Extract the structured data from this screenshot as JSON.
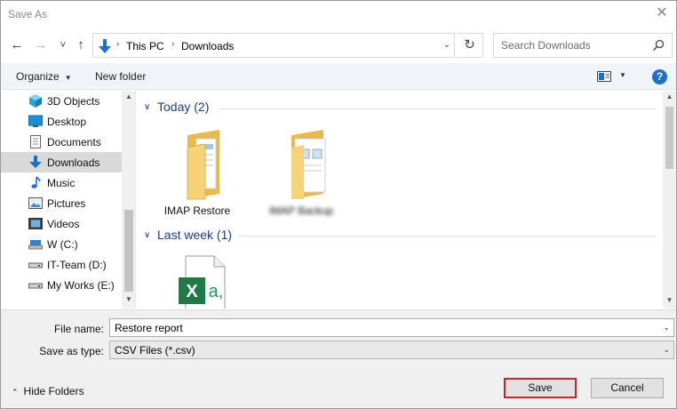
{
  "window": {
    "title": "Save As",
    "close_glyph": "✕"
  },
  "nav": {
    "back_glyph": "←",
    "forward_glyph": "→",
    "recent_glyph": "˅",
    "up_glyph": "↑",
    "breadcrumb": [
      "This PC",
      "Downloads"
    ],
    "breadcrumb_sep": "›",
    "address_dropdown_glyph": "⌄",
    "refresh_glyph": "↻",
    "search_placeholder": "Search Downloads"
  },
  "toolbar": {
    "organize_label": "Organize",
    "new_folder_label": "New folder",
    "help_glyph": "?",
    "dropdown_glyph": "▼"
  },
  "sidebar": {
    "items": [
      {
        "label": "3D Objects",
        "icon": "3d-objects-icon"
      },
      {
        "label": "Desktop",
        "icon": "desktop-icon"
      },
      {
        "label": "Documents",
        "icon": "documents-icon"
      },
      {
        "label": "Downloads",
        "icon": "downloads-icon",
        "selected": true
      },
      {
        "label": "Music",
        "icon": "music-icon"
      },
      {
        "label": "Pictures",
        "icon": "pictures-icon"
      },
      {
        "label": "Videos",
        "icon": "videos-icon"
      },
      {
        "label": "W (C:)",
        "icon": "drive-icon"
      },
      {
        "label": "IT-Team (D:)",
        "icon": "drive-icon"
      },
      {
        "label": "My Works (E:)",
        "icon": "drive-icon"
      }
    ],
    "scroll_up_glyph": "▲",
    "scroll_down_glyph": "▼"
  },
  "content": {
    "groups": [
      {
        "header": "Today (2)",
        "chevron": "∨",
        "files": [
          {
            "name": "IMAP Restore",
            "type": "folder"
          },
          {
            "name": "IMAP Backup",
            "type": "folder",
            "blurred": true
          }
        ]
      },
      {
        "header": "Last week (1)",
        "chevron": "∨",
        "files": [
          {
            "name": "",
            "type": "csv"
          }
        ]
      }
    ],
    "csv_glyph_x": "X",
    "csv_glyph_a": "a,"
  },
  "form": {
    "file_name_label": "File name:",
    "file_name_value": "Restore report",
    "save_type_label": "Save as type:",
    "save_type_value": "CSV Files (*.csv)",
    "dropdown_glyph": "⌄",
    "hide_folders_label": "Hide Folders",
    "hide_folders_glyph": "⌃",
    "save_label": "Save",
    "cancel_label": "Cancel"
  },
  "colors": {
    "accent": "#1a6fcf",
    "group_header": "#1e3a8a",
    "save_highlight": "#c9252b",
    "folder": "#f3c85d"
  }
}
